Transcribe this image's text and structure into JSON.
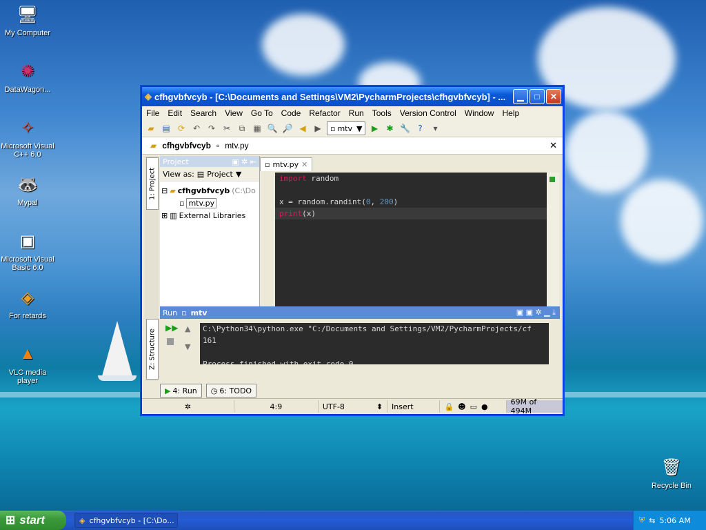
{
  "desktop": {
    "icons": [
      {
        "label": "My Computer",
        "icon": "computer-icon"
      },
      {
        "label": "DataWagon...",
        "icon": "datawagon-icon"
      },
      {
        "label": "Microsoft Visual C++ 6.0",
        "icon": "visual-cpp-icon"
      },
      {
        "label": "Mypal",
        "icon": "mypal-icon"
      },
      {
        "label": "Microsoft Visual Basic 6.0",
        "icon": "visual-basic-icon"
      },
      {
        "label": "For retards",
        "icon": "pycharm-shortcut-icon"
      },
      {
        "label": "VLC media player",
        "icon": "vlc-icon"
      },
      {
        "label": "Recycle Bin",
        "icon": "recycle-bin-icon"
      }
    ]
  },
  "window": {
    "title": "cfhgvbfvcyb - [C:\\Documents and Settings\\VM2\\PycharmProjects\\cfhgvbfvcyb] - ...",
    "menu": [
      "File",
      "Edit",
      "Search",
      "View",
      "Go To",
      "Code",
      "Refactor",
      "Run",
      "Tools",
      "Version Control",
      "Window",
      "Help"
    ],
    "run_config": "mtv",
    "nav": {
      "project": "cfhgvbfvcyb",
      "file": "mtv.py"
    },
    "side_tabs": {
      "project": "1: Project",
      "structure": "Z: Structure"
    },
    "project_panel": {
      "header": "Project",
      "view_as_label": "View as:",
      "view_as_value": "Project",
      "tree": [
        {
          "label": "cfhgvbfvcyb",
          "hint": "(C:\\Do",
          "kind": "folder"
        },
        {
          "label": "mtv.py",
          "kind": "file"
        },
        {
          "label": "External Libraries",
          "kind": "library"
        }
      ]
    },
    "editor": {
      "tab": "mtv.py",
      "lines": [
        {
          "k": "import",
          "rest": " random"
        },
        {
          "k": "",
          "rest": ""
        },
        {
          "k": "",
          "rest": "x = random.randint(0, 200)"
        },
        {
          "k": "print",
          "rest": "(x)"
        }
      ]
    },
    "run_panel": {
      "header": "Run",
      "config": "mtv",
      "output": [
        "C:\\Python34\\python.exe \"C:/Documents and Settings/VM2/PycharmProjects/cf",
        "161",
        "",
        "Process finished with exit code 0"
      ]
    },
    "bottom_tabs": {
      "run": "4: Run",
      "todo": "6: TODO"
    },
    "status": {
      "position": "4:9",
      "encoding": "UTF-8",
      "mode": "Insert",
      "memory": "69M of 494M"
    }
  },
  "taskbar": {
    "start": "start",
    "task": "cfhgvbfvcyb - [C:\\Do...",
    "clock": "5:06 AM"
  },
  "colors": {
    "keyword": "#cc1f5a",
    "number": "#6897bb",
    "editor_bg": "#2b2b2b",
    "xp_blue": "#0a58d8",
    "start_green": "#3c9a3c"
  }
}
